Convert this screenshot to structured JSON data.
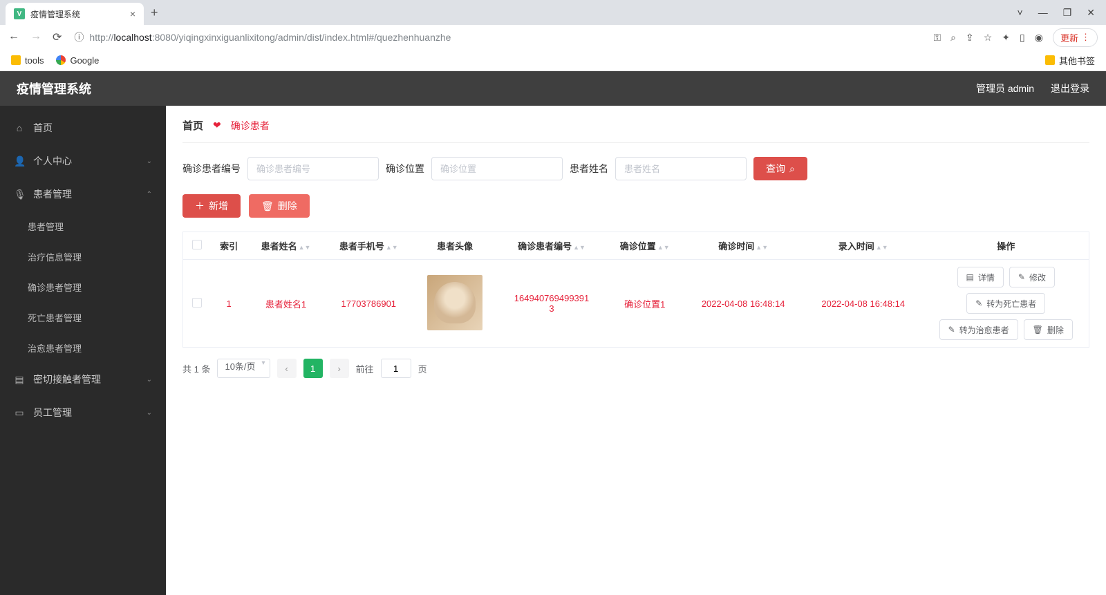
{
  "browser": {
    "tab_title": "疫情管理系统",
    "url_prefix": "http://",
    "url_host": "localhost",
    "url_rest": ":8080/yiqingxinxiguanlixitong/admin/dist/index.html#/quezhenhuanzhe",
    "update_btn": "更新",
    "bm_tools": "tools",
    "bm_google": "Google",
    "bm_other": "其他书签"
  },
  "header": {
    "title": "疫情管理系统",
    "user_label": "管理员 admin",
    "logout": "退出登录"
  },
  "sidebar": {
    "home": "首页",
    "personal": "个人中心",
    "patient_mgmt": "患者管理",
    "subs": [
      "患者管理",
      "治疗信息管理",
      "确诊患者管理",
      "死亡患者管理",
      "治愈患者管理"
    ],
    "contact": "密切接触者管理",
    "staff": "员工管理"
  },
  "breadcrumb": {
    "home": "首页",
    "current": "确诊患者"
  },
  "search": {
    "label1": "确诊患者编号",
    "ph1": "确诊患者编号",
    "label2": "确诊位置",
    "ph2": "确诊位置",
    "label3": "患者姓名",
    "ph3": "患者姓名",
    "query_btn": "查询"
  },
  "actions": {
    "add": "新增",
    "del": "删除"
  },
  "table": {
    "cols": [
      "索引",
      "患者姓名",
      "患者手机号",
      "患者头像",
      "确诊患者编号",
      "确诊位置",
      "确诊时间",
      "录入时间",
      "操作"
    ],
    "row": {
      "index": "1",
      "name": "患者姓名1",
      "phone": "17703786901",
      "code": "1649407694993913",
      "code_display1": "164940769499391",
      "code_display2": "3",
      "loc": "确诊位置1",
      "diag_time": "2022-04-08 16:48:14",
      "entry_time": "2022-04-08 16:48:14",
      "ops": {
        "detail": "详情",
        "edit": "修改",
        "to_death": "转为死亡患者",
        "to_cure": "转为治愈患者",
        "del": "删除"
      }
    }
  },
  "pagination": {
    "total": "共 1 条",
    "pagesize": "10条/页",
    "goto": "前往",
    "page": "1",
    "unit": "页"
  }
}
